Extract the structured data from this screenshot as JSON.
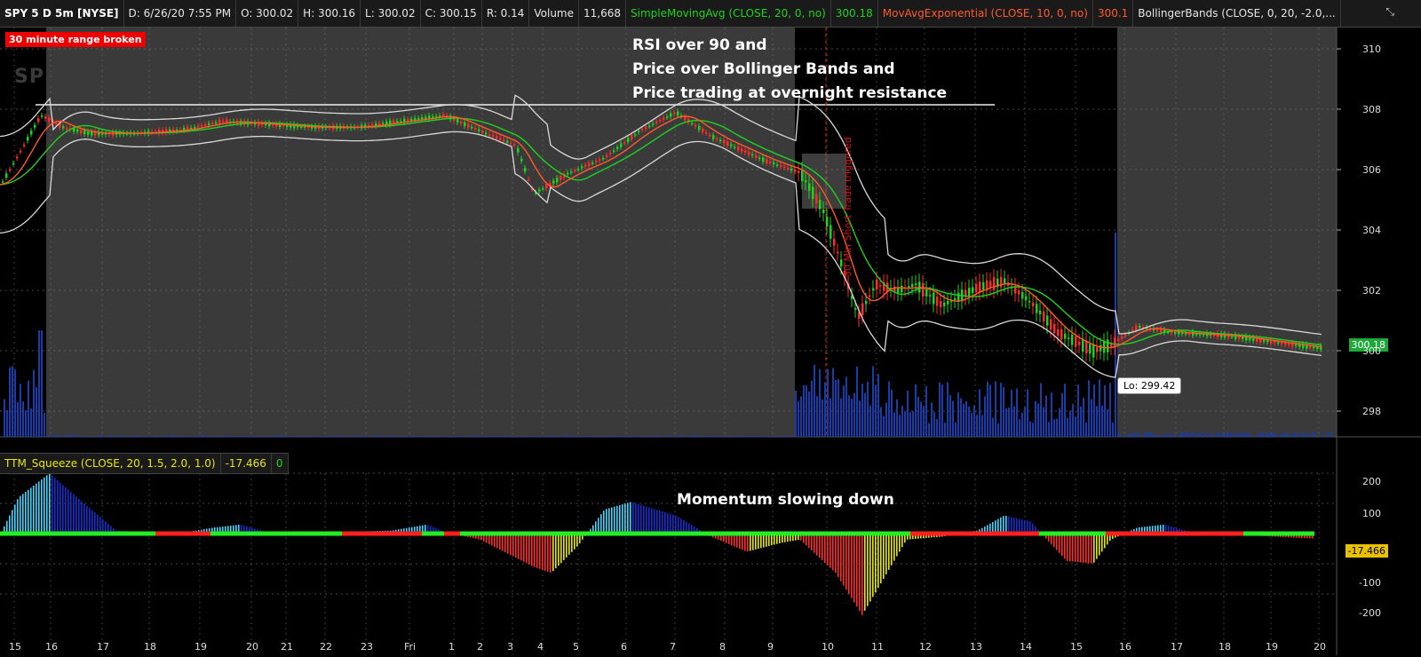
{
  "header": {
    "symbol": "SPY 5 D 5m [NYSE]",
    "date": "D: 6/26/20 7:55 PM",
    "open": "O: 300.02",
    "high": "H: 300.16",
    "low": "L: 300.02",
    "close": "C: 300.15",
    "range": "R: 0.14",
    "volume_label": "Volume",
    "volume_value": "11,668",
    "sma_label": "SimpleMovingAvg (CLOSE, 20, 0, no)",
    "sma_value": "300.18",
    "ema_label": "MovAvgExponential (CLOSE, 10, 0, no)",
    "ema_value": "300.1",
    "bb_label": "BollingerBands (CLOSE, 0, 20, -2.0,..."
  },
  "annotations": {
    "range_badge": "30 minute range broken",
    "watermark": "SPDRs",
    "note_lines": [
      "RSI over 90 and",
      "Price over Bollinger Bands and",
      "Price trading at overnight resistance"
    ],
    "vertical_note": "30 Min Short Trade triggered",
    "low_label": "Lo: 299.42",
    "momentum_note": "Momentum slowing down",
    "last_price": "300.18",
    "last_momentum": "-17.466"
  },
  "ttm": {
    "label": "TTM_Squeeze (CLOSE, 20, 1.5, 2.0, 1.0)",
    "value": "-17.466",
    "squeeze": "0"
  },
  "price_axis": [
    "310",
    "308",
    "306",
    "304",
    "302",
    "300",
    "298"
  ],
  "momentum_axis": [
    "200",
    "100",
    "-100",
    "-200"
  ],
  "time_axis": [
    "15",
    "16",
    "17",
    "18",
    "19",
    "20",
    "21",
    "22",
    "23",
    "Fri",
    "1",
    "2",
    "3",
    "4",
    "5",
    "6",
    "7",
    "8",
    "9",
    "10",
    "11",
    "12",
    "13",
    "14",
    "15",
    "16",
    "17",
    "18",
    "19",
    "20"
  ],
  "colors": {
    "sma": "#1fd21f",
    "ema": "#ff5a2a",
    "bollinger": "#d8d8d8",
    "up_candle": "#1fd21f",
    "down_candle": "#ff2a2a",
    "volume": "#1a3ca8",
    "hist_up_strong": "#3ed6ff",
    "hist_up_weak": "#1a2ccc",
    "hist_down_strong": "#ff2a2a",
    "hist_down_weak": "#e8e800",
    "squeeze_on": "#ff2020",
    "squeeze_off": "#22ee22"
  }
}
